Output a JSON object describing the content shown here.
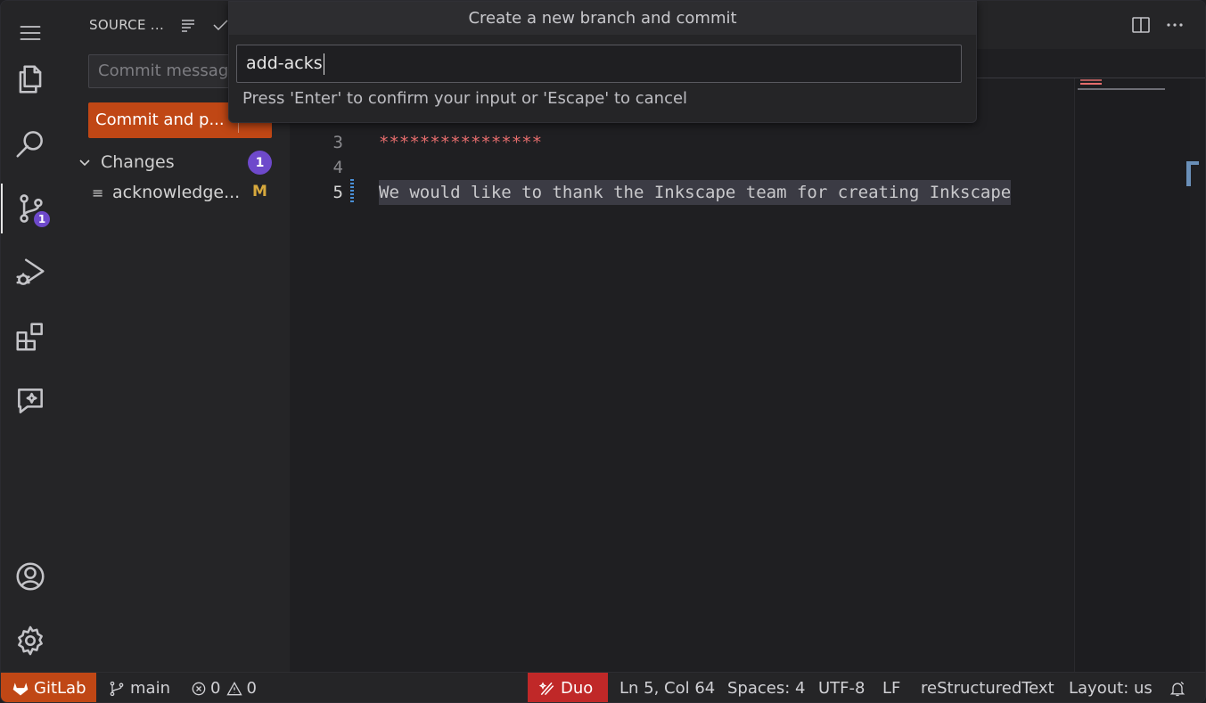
{
  "activity_bar": {
    "items": [
      "explorer",
      "search",
      "source-control",
      "run-debug",
      "extensions",
      "chat"
    ],
    "scm_badge": "1",
    "bottom": [
      "accounts",
      "manage"
    ]
  },
  "sidebar": {
    "title": "SOURCE ...",
    "commit_placeholder": "Commit messag",
    "commit_button": "Commit and p...",
    "changes_label": "Changes",
    "changes_count": "1",
    "file_name": "acknowledge...",
    "file_status": "M"
  },
  "quick_input": {
    "title": "Create a new branch and commit",
    "value": "add-acks",
    "hint": "Press 'Enter' to confirm your input or 'Escape' to cancel"
  },
  "editor": {
    "lines": [
      {
        "number": "3",
        "text": "****************"
      },
      {
        "number": "4",
        "text": ""
      },
      {
        "number": "5",
        "text": "We would like to thank the Inkscape team for creating Inkscape"
      }
    ]
  },
  "status_bar": {
    "gitlab": "GitLab",
    "branch": "main",
    "errors": "0",
    "warnings": "0",
    "duo": "Duo",
    "position": "Ln 5, Col 64",
    "spaces": "Spaces: 4",
    "encoding": "UTF-8",
    "eol": "LF",
    "language": "reStructuredText",
    "layout": "Layout: us"
  },
  "colors": {
    "accent_orange": "#c04715",
    "badge_purple": "#6e49cb",
    "duo_red": "#c02828"
  }
}
